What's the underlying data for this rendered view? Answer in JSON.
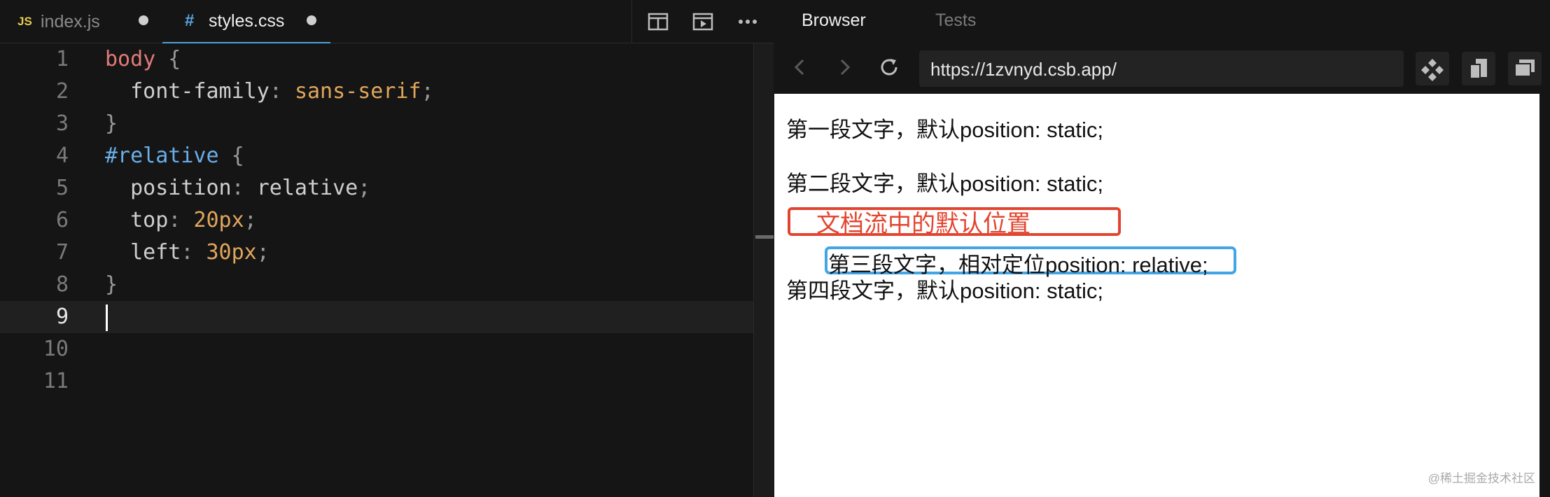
{
  "editor": {
    "tabs": [
      {
        "badge": "JS",
        "label": "index.js"
      },
      {
        "badge": "#",
        "label": "styles.css"
      }
    ],
    "toolbar_icons": [
      "split-view-icon",
      "preview-icon",
      "more-icon"
    ],
    "line_numbers": [
      "1",
      "2",
      "3",
      "4",
      "5",
      "6",
      "7",
      "8",
      "9",
      "10",
      "11"
    ],
    "active_line": 9,
    "code": {
      "l1_sel": "body",
      "l1_brace": " {",
      "l2_prop": "  font-family",
      "l2_colon": ": ",
      "l2_val": "sans-serif",
      "l2_semi": ";",
      "l3": "}",
      "l4_sel": "#relative",
      "l4_brace": " {",
      "l5_prop": "  position",
      "l5_colon": ": ",
      "l5_val": "relative",
      "l5_semi": ";",
      "l6_prop": "  top",
      "l6_colon": ": ",
      "l6_val": "20px",
      "l6_semi": ";",
      "l7_prop": "  left",
      "l7_colon": ": ",
      "l7_val": "30px",
      "l7_semi": ";",
      "l8": "}"
    }
  },
  "browser": {
    "tabs": {
      "active": "Browser",
      "inactive": "Tests"
    },
    "url": "https://1zvnyd.csb.app/",
    "page": {
      "p1": "第一段文字，默认position: static;",
      "p2": "第二段文字，默认position: static;",
      "p3": "第三段文字，相对定位position: relative;",
      "p4": "第四段文字，默认position: static;",
      "annotation": "文档流中的默认位置"
    },
    "watermark": "@稀土掘金技术社区"
  },
  "colors": {
    "selector": "#e07b78",
    "id_selector": "#6aaee8",
    "value": "#e0a65c",
    "annotation_red": "#e2452f",
    "annotation_blue": "#44a5e6"
  }
}
